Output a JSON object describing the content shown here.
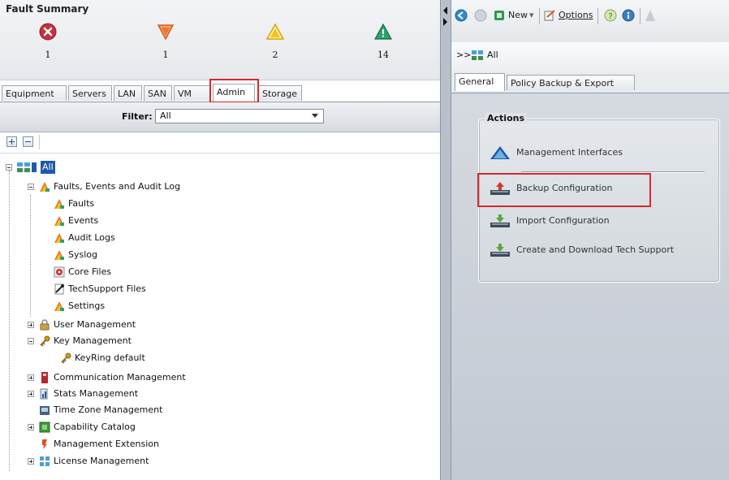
{
  "fault_summary": {
    "title": "Fault Summary",
    "items": [
      {
        "severity": "critical",
        "count": "1",
        "color": "#c8303a",
        "icon": "critical-x-icon"
      },
      {
        "severity": "major",
        "count": "1",
        "color": "#e9772e",
        "icon": "major-triangle-down-icon"
      },
      {
        "severity": "minor",
        "count": "2",
        "color": "#f4c21f",
        "icon": "minor-warning-triangle-icon"
      },
      {
        "severity": "warning",
        "count": "14",
        "color": "#2aa46b",
        "icon": "warning-triangle-icon"
      }
    ]
  },
  "left_tabs": [
    {
      "label": "Equipment"
    },
    {
      "label": "Servers"
    },
    {
      "label": "LAN"
    },
    {
      "label": "SAN"
    },
    {
      "label": "VM"
    },
    {
      "label": "Admin",
      "active": true
    },
    {
      "label": "Storage"
    }
  ],
  "filter": {
    "label": "Filter:",
    "value": "All"
  },
  "tree": {
    "root": "All",
    "items": [
      {
        "label": "Faults, Events and Audit Log",
        "icon": "fault-log-icon",
        "expanded": true
      },
      {
        "label": "Faults",
        "icon": "faults-icon"
      },
      {
        "label": "Events",
        "icon": "events-icon"
      },
      {
        "label": "Audit Logs",
        "icon": "audit-logs-icon"
      },
      {
        "label": "Syslog",
        "icon": "syslog-icon"
      },
      {
        "label": "Core Files",
        "icon": "core-files-icon"
      },
      {
        "label": "TechSupport Files",
        "icon": "techsupport-files-icon"
      },
      {
        "label": "Settings",
        "icon": "settings-icon"
      },
      {
        "label": "User Management",
        "icon": "lock-icon",
        "expanded": false
      },
      {
        "label": "Key Management",
        "icon": "key-icon",
        "expanded": true
      },
      {
        "label": "KeyRing default",
        "icon": "key-icon"
      },
      {
        "label": "Communication Management",
        "icon": "communication-icon",
        "expanded": false
      },
      {
        "label": "Stats Management",
        "icon": "stats-icon",
        "expanded": false
      },
      {
        "label": "Time Zone Management",
        "icon": "time-zone-icon"
      },
      {
        "label": "Capability Catalog",
        "icon": "catalog-icon",
        "expanded": false
      },
      {
        "label": "Management Extension",
        "icon": "extension-icon"
      },
      {
        "label": "License Management",
        "icon": "license-icon",
        "expanded": false
      }
    ]
  },
  "right_toolbar": {
    "new_label": "New",
    "options_label": "Options"
  },
  "nav_path": {
    "prefix": ">>",
    "label": "All"
  },
  "right_tabs": [
    {
      "label": "General",
      "active": true
    },
    {
      "label": "Policy Backup & Export"
    }
  ],
  "actions": {
    "title": "Actions",
    "items": [
      {
        "label": "Management Interfaces",
        "icon": "management-interfaces-icon"
      },
      {
        "label": "Backup Configuration",
        "icon": "backup-configuration-icon"
      },
      {
        "label": "Import Configuration",
        "icon": "import-configuration-icon"
      },
      {
        "label": "Create and Download Tech Support",
        "icon": "download-tech-support-icon"
      }
    ]
  },
  "colors": {
    "highlight": "#d9262b",
    "accent": "#1f5aa8"
  }
}
